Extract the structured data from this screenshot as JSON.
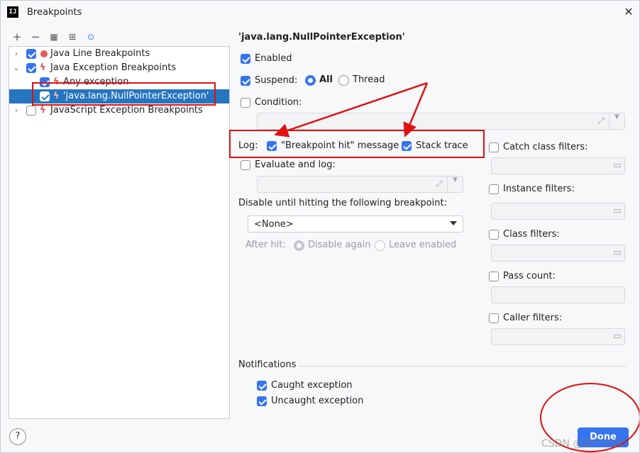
{
  "window": {
    "title": "Breakpoints",
    "app_icon_text": "IJ"
  },
  "toolbar": {
    "add": "+",
    "remove": "−",
    "group": "▦",
    "export": "⊞",
    "settings": "⊙"
  },
  "tree": [
    {
      "label": "Java Line Breakpoints",
      "checked": true,
      "icon": "circle"
    },
    {
      "label": "Java Exception Breakpoints",
      "checked": true,
      "icon": "bolt"
    },
    {
      "label": "Any exception",
      "checked": true,
      "icon": "bolt"
    },
    {
      "label": "'java.lang.NullPointerException'",
      "checked": true,
      "icon": "bolt",
      "selected": true
    },
    {
      "label": "JavaScript Exception Breakpoints",
      "checked": false,
      "icon": "bolt"
    }
  ],
  "detail": {
    "title": "'java.lang.NullPointerException'",
    "enabled_label": "Enabled",
    "suspend_label": "Suspend:",
    "suspend_all": "All",
    "suspend_thread": "Thread",
    "condition_label": "Condition:",
    "log_label": "Log:",
    "log_message": "\"Breakpoint hit\" message",
    "log_stack": "Stack trace",
    "evaluate_label": "Evaluate and log:",
    "disable_until_label": "Disable until hitting the following breakpoint:",
    "disable_select": "<None>",
    "after_hit_label": "After hit:",
    "after_disable": "Disable again",
    "after_leave": "Leave enabled",
    "catch_filters": "Catch class filters:",
    "instance_filters": "Instance filters:",
    "class_filters": "Class filters:",
    "pass_count": "Pass count:",
    "caller_filters": "Caller filters:",
    "notifications": "Notifications",
    "caught": "Caught exception",
    "uncaught": "Uncaught exception"
  },
  "footer": {
    "help": "?",
    "done": "Done"
  },
  "watermark": "CSDN @李子大叔",
  "colors": {
    "accent": "#3574f0",
    "selection": "#2675bf",
    "annotation": "#e01010"
  }
}
